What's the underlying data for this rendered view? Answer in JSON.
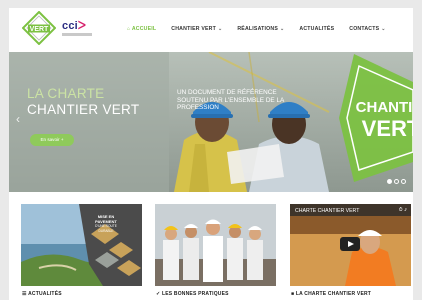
{
  "header": {
    "logo_text": "VERT",
    "cci_text": "cci",
    "nav": [
      {
        "label": "ACCUEIL",
        "active": true
      },
      {
        "label": "CHANTIER VERT",
        "has_dropdown": true
      },
      {
        "label": "RÉALISATIONS",
        "has_dropdown": true
      },
      {
        "label": "ACTUALITÉS"
      },
      {
        "label": "CONTACTS",
        "has_dropdown": true
      }
    ]
  },
  "hero": {
    "title_line1": "LA CHARTE",
    "title_line2": "CHANTIER VERT",
    "subtitle_line1": "UN DOCUMENT DE RÉFÉRENCE",
    "subtitle_line2": "SOUTENU PAR L'ENSEMBLE DE LA",
    "subtitle_line3": "PROFESSION",
    "button_label": "En savoir +",
    "badge_line1": "CHANTIE",
    "badge_line2": "VERT",
    "slide_count": 3,
    "active_slide": 1
  },
  "cards": [
    {
      "label": "ACTUALITÉS",
      "badge_line1": "MISE EN PAVEMENT",
      "badge_line2": "D'UNE ROUTE DURABLE"
    },
    {
      "label": "LES BONNES PRATIQUES"
    },
    {
      "label": "LA CHARTE CHANTIER VERT",
      "video_title": "CHARTE CHANTIER VERT"
    }
  ],
  "colors": {
    "accent_green": "#7cc142",
    "button_green": "#8fca5b",
    "cci_blue": "#2c2e83",
    "cci_pink": "#d61f6b"
  }
}
